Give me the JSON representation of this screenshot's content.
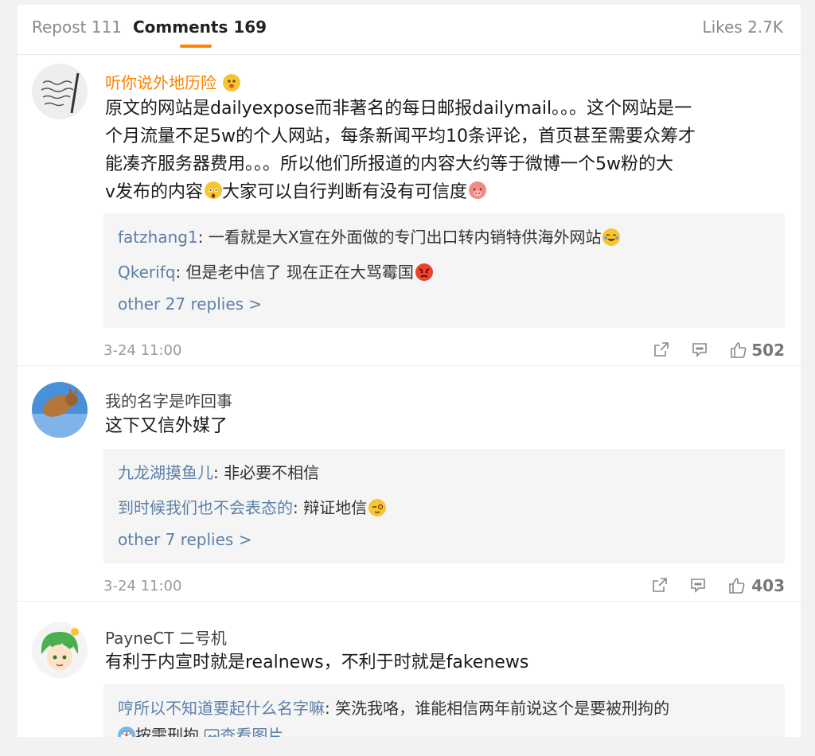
{
  "tabs": {
    "repost": "Repost 111",
    "comments": "Comments 169",
    "likes": "Likes 2.7K"
  },
  "accent_color": "#ff8200",
  "link_color": "#5d7fa8",
  "comments": [
    {
      "username": "听你说外地历险",
      "text_1": "原文的网站是dailyexpose而非著名的每日邮报dailymail。。。这个网站是一",
      "text_2": "个月流量不足5w的个人网站，每条新闻平均10条评论，首页甚至需要众筹才",
      "text_3": "能凑齐服务器费用。。。所以他们所报道的内容大约等于微博一个5w粉的大",
      "text_4a": "v发布的内容",
      "text_4b": "大家可以自行判断有没有可信度",
      "replies": [
        {
          "name": "fatzhang1",
          "text": ": 一看就是大X宣在外面做的专门出口转内销特供海外网站"
        },
        {
          "name": "Qkerifq",
          "text": ": 但是老中信了 现在正在大骂霉国"
        }
      ],
      "more": "other 27 replies >",
      "time": "3-24 11:00",
      "likes": "502"
    },
    {
      "username": "我的名字是咋回事",
      "text_1": "这下又信外媒了",
      "replies": [
        {
          "name": "九龙湖摸鱼儿",
          "text": ": 非必要不相信"
        },
        {
          "name": "到时候我们也不会表态的",
          "text": ": 辩证地信"
        }
      ],
      "more": "other 7 replies >",
      "time": "3-24 11:00",
      "likes": "403"
    },
    {
      "username": "PayneCT 二号机",
      "text_1": "有利于内宣时就是realnews，不利于时就是fakenews",
      "replies": [
        {
          "name": "哼所以不知道要起什么名字嘛",
          "text": ": 笑洗我咯，谁能相信两年前说这个是要被刑拘的"
        }
      ],
      "reply_line2_text": "按需刑拘",
      "reply_view_image": "查看图片"
    }
  ],
  "icons": [
    "share-icon",
    "comment-icon",
    "thumbs-up-icon",
    "image-icon"
  ]
}
